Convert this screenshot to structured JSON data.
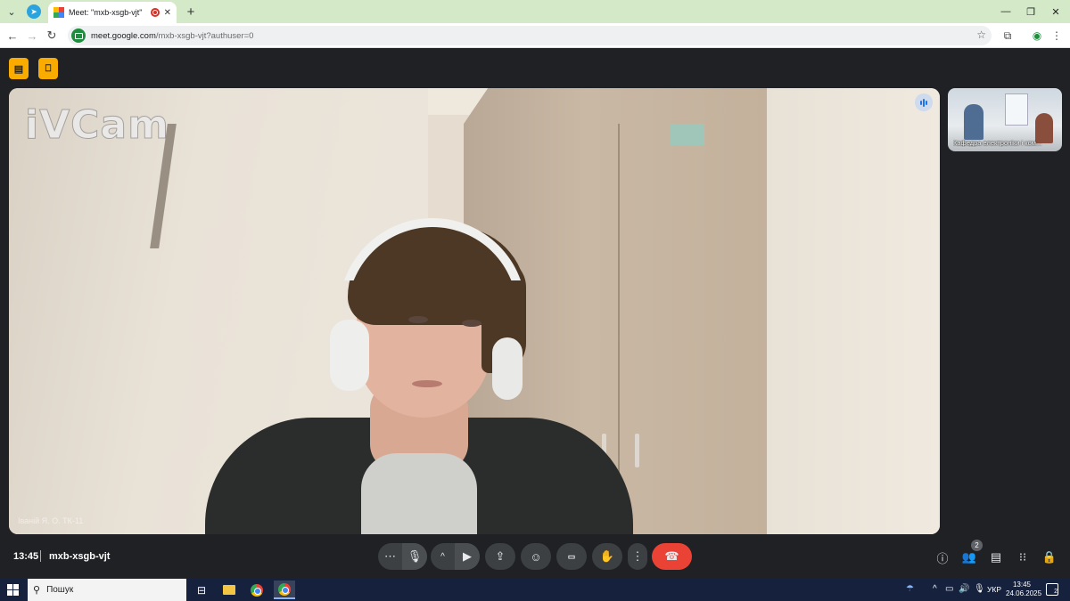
{
  "browser": {
    "active_tab_title": "Meet: \"mxb-xsgb-vjt\"",
    "url_host": "meet.google.com",
    "url_path": "/mxb-xsgb-vjt?authuser=0"
  },
  "meet": {
    "watermark": "iVCam",
    "main_participant_name": "Іваній Я. О. ТК-11",
    "thumbnail_label": "Кафедра електроніки і ком...",
    "time": "13:45",
    "meeting_code": "mxb-xsgb-vjt",
    "participant_count": "2",
    "end_call_color": "#ea4335",
    "accent_color": "#f9ab00"
  },
  "taskbar": {
    "search_placeholder": "Пошук",
    "language": "УКР",
    "clock_time": "13:45",
    "clock_date": "24.06.2025",
    "notification_count": "2"
  }
}
